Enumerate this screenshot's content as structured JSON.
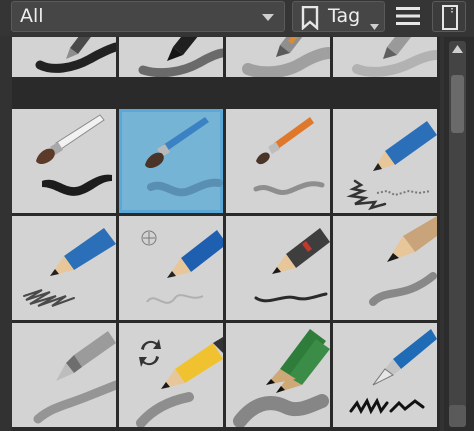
{
  "toolbar": {
    "filter_value": "All",
    "filter_icon": "chevron-down-icon",
    "tag_label": "Tag",
    "tag_icon": "bookmark-icon",
    "menu_icon": "hamburger-menu-icon",
    "view_icon": "document-icon"
  },
  "presets": {
    "count_visible_rows": 4,
    "columns": 4,
    "selected_index": 5,
    "items": [
      {
        "icon": "pen-icon"
      },
      {
        "icon": "marker-icon"
      },
      {
        "icon": "airbrush-pen-icon"
      },
      {
        "icon": "pencil-soft-icon"
      },
      {
        "icon": "ink-brush-icon"
      },
      {
        "icon": "watercolor-brush-icon"
      },
      {
        "icon": "round-brush-icon"
      },
      {
        "icon": "blue-pencil-stipple-icon"
      },
      {
        "icon": "blue-pencil-scribble-icon"
      },
      {
        "icon": "blue-pencil-light-icon"
      },
      {
        "icon": "graphite-pencil-icon"
      },
      {
        "icon": "wood-pencil-shading-icon"
      },
      {
        "icon": "mechanical-pencil-icon"
      },
      {
        "icon": "pencil-rotate-icon"
      },
      {
        "icon": "charcoal-pencils-icon"
      },
      {
        "icon": "fountain-pen-icon"
      }
    ]
  },
  "colors": {
    "cell_bg": "#d3d3d3",
    "selected_bg": "#76b4d6",
    "panel_bg": "#323232"
  }
}
